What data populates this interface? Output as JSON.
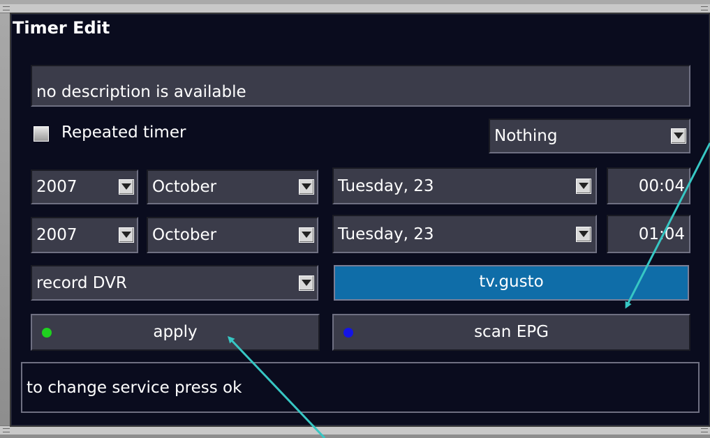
{
  "window": {
    "title": "Timer Edit"
  },
  "description": {
    "value": "no description is available"
  },
  "repeat": {
    "label": "Repeated timer",
    "checked": false
  },
  "after_event": {
    "value": "Nothing"
  },
  "begin": {
    "year": "2007",
    "month": "October",
    "day": "Tuesday, 23",
    "time": "00:04"
  },
  "end": {
    "year": "2007",
    "month": "October",
    "day": "Tuesday, 23",
    "time": "01:04"
  },
  "record_type": {
    "value": "record DVR"
  },
  "service": {
    "value": "tv.gusto"
  },
  "buttons": {
    "apply": {
      "label": "apply",
      "key_color": "#1fd21f"
    },
    "scan": {
      "label": "scan EPG",
      "key_color": "#1414e6"
    }
  },
  "status": {
    "text": "to change service press ok"
  },
  "colors": {
    "accent": "#0f6da8",
    "background": "#0a0c1e",
    "field": "#3b3c4a",
    "annotation_arrow": "#37c7c4"
  }
}
